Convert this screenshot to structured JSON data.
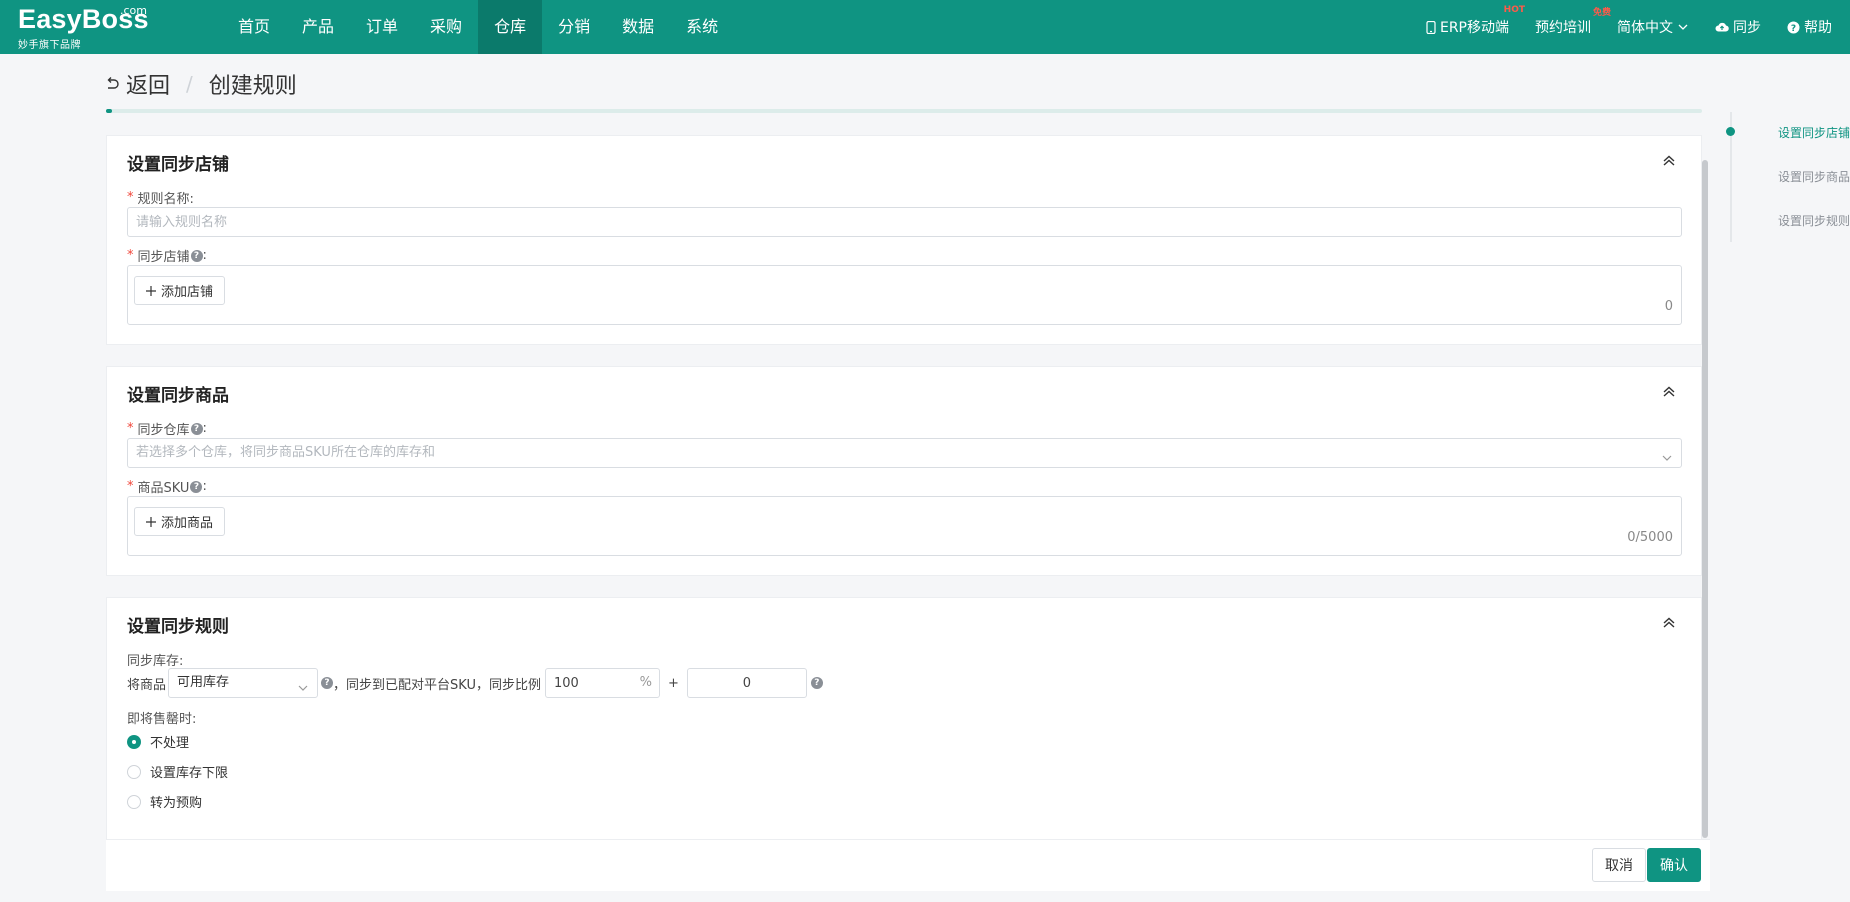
{
  "brand": {
    "name": "EasyBoss",
    "dotcom": ".com",
    "tagline": "妙手旗下品牌"
  },
  "nav": {
    "items": [
      "首页",
      "产品",
      "订单",
      "采购",
      "仓库",
      "分销",
      "数据",
      "系统"
    ],
    "active": "仓库"
  },
  "rightnav": {
    "erp": "ERP移动端",
    "erp_tag": "HOT",
    "training": "预约培训",
    "training_tag": "免费",
    "language": "简体中文",
    "sync": "同步",
    "help": "帮助"
  },
  "header": {
    "back": "返回",
    "title": "创建规则",
    "progress_percent": 0.4
  },
  "store_section": {
    "title": "设置同步店铺",
    "rule_name_label": "规则名称:",
    "rule_name_placeholder": "请输入规则名称",
    "store_label": "同步店铺",
    "add_store": "添加店铺",
    "store_count": "0"
  },
  "product_section": {
    "title": "设置同步商品",
    "warehouse_label": "同步仓库",
    "warehouse_placeholder": "若选择多个仓库，将同步商品SKU所在仓库的库存和",
    "sku_label": "商品SKU",
    "add_product": "添加商品",
    "sku_count": "0/5000"
  },
  "rule_section": {
    "title": "设置同步规则",
    "stock_label": "同步库存:",
    "prefix": "将商品",
    "stock_type": "可用库存",
    "middle": "，同步到已配对平台SKU，同步比例",
    "ratio": "100",
    "ratio_suffix": "%",
    "plus": "+",
    "offset": "0",
    "soldout_label": "即将售罄时:",
    "options": [
      "不处理",
      "设置库存下限",
      "转为预购"
    ],
    "selected": "不处理"
  },
  "footer": {
    "cancel": "取消",
    "confirm": "确认"
  },
  "anchor": {
    "items": [
      "设置同步店铺",
      "设置同步商品",
      "设置同步规则"
    ],
    "active": "设置同步店铺"
  },
  "colors": {
    "primary": "#0f9482",
    "nav_active": "#0b7a6b",
    "required": "#f04438",
    "tag": "#ff5a4a"
  }
}
